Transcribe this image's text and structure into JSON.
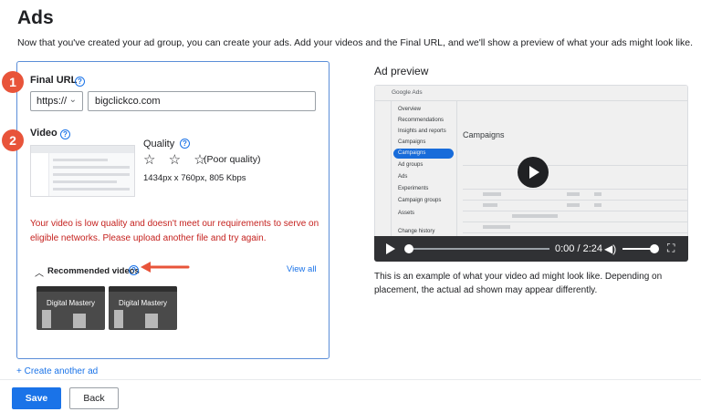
{
  "page": {
    "title": "Ads",
    "subtitle": "Now that you've created your ad group, you can create your ads. Add your videos and the Final URL, and we'll show a preview of what your ads might look like."
  },
  "badges": {
    "one": "1",
    "two": "2"
  },
  "final_url": {
    "label": "Final URL",
    "protocol": "https://",
    "value": "bigclickco.com"
  },
  "video": {
    "label": "Video",
    "quality_label": "Quality",
    "stars": "☆ ☆ ☆",
    "quality_value": "(Poor quality)",
    "specs": "1434px x 760px, 805 Kbps",
    "error": "Your video is low quality and doesn't meet our requirements to serve on eligible networks. Please upload another file and try again."
  },
  "recommended": {
    "label": "Recommended videos",
    "view_all": "View all",
    "items": [
      {
        "caption": "Digital Mastery"
      },
      {
        "caption": "Digital Mastery"
      }
    ]
  },
  "create_another": "+ Create another ad",
  "buttons": {
    "save": "Save",
    "back": "Back"
  },
  "preview": {
    "title": "Ad preview",
    "time": "0:00 / 2:24",
    "note": "This is an example of what your video ad might look like. Depending on placement, the actual ad shown may appear differently.",
    "mini_logo": "Google Ads",
    "mini_heading": "Campaigns",
    "mini_nav": [
      "Overview",
      "Recommendations",
      "Insights and reports",
      "Campaigns",
      "Campaigns",
      "Ad groups",
      "Ads",
      "Experiments",
      "Campaign groups",
      "Assets",
      "Change history"
    ]
  },
  "colors": {
    "accent": "#1a73e8",
    "error": "#c5221f",
    "badge": "#e8543a",
    "card_border": "#5b8ed8"
  }
}
